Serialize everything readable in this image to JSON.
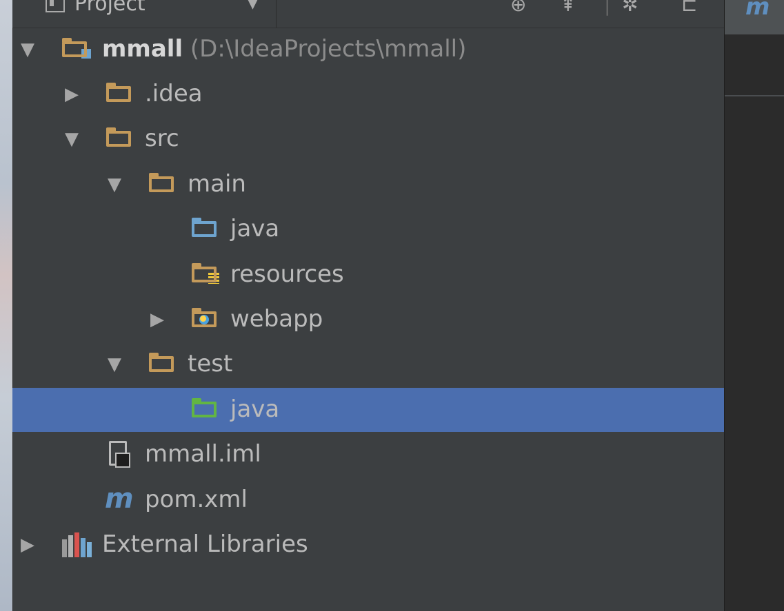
{
  "header": {
    "title": "Project",
    "caret": "▼"
  },
  "editor_tab": {
    "glyph": "m"
  },
  "tree": [
    {
      "label": "mmall",
      "path": "(D:\\IdeaProjects\\mmall)",
      "arrow": "▼",
      "icon": "module-folder-icon"
    },
    {
      "label": ".idea",
      "arrow": "▶",
      "icon": "folder-icon"
    },
    {
      "label": "src",
      "arrow": "▼",
      "icon": "folder-icon"
    },
    {
      "label": "main",
      "arrow": "▼",
      "icon": "folder-icon"
    },
    {
      "label": "java",
      "arrow": "",
      "icon": "source-root-icon"
    },
    {
      "label": "resources",
      "arrow": "",
      "icon": "resources-root-icon"
    },
    {
      "label": "webapp",
      "arrow": "▶",
      "icon": "web-folder-icon"
    },
    {
      "label": "test",
      "arrow": "▼",
      "icon": "folder-icon"
    },
    {
      "label": "java",
      "arrow": "",
      "icon": "test-root-icon",
      "selected": true
    },
    {
      "label": "mmall.iml",
      "arrow": "",
      "icon": "iml-file-icon"
    },
    {
      "label": "pom.xml",
      "arrow": "",
      "icon": "maven-icon"
    },
    {
      "label": "External Libraries",
      "arrow": "▶",
      "icon": "libraries-icon"
    }
  ],
  "colors": {
    "background": "#3c3f41",
    "selection": "#4b6eaf",
    "folder": "#c49a5a",
    "source_root": "#6ea4cf",
    "test_root": "#62b543"
  }
}
